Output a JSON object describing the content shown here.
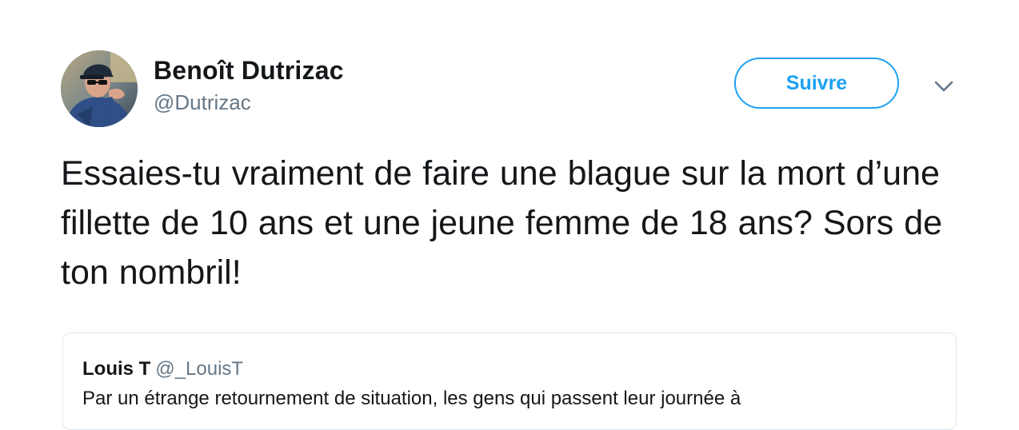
{
  "tweet": {
    "author": {
      "name": "Benoît Dutrizac",
      "handle": "@Dutrizac",
      "avatar_icon": "user-avatar-photo"
    },
    "follow_label": "Suivre",
    "menu_icon": "chevron-down-icon",
    "text": "Essaies-tu vraiment de faire une blague sur la mort d’une fillette de 10 ans et une jeune femme de 18 ans? Sors de ton nombril!"
  },
  "quoted_tweet": {
    "name": "Louis T",
    "handle": "@_LouisT",
    "text": "Par un étrange retournement de situation, les gens qui passent leur journée à"
  },
  "colors": {
    "accent": "#1da1f2",
    "text_primary": "#14171a",
    "text_secondary": "#657786",
    "border": "#e1e8ed"
  }
}
